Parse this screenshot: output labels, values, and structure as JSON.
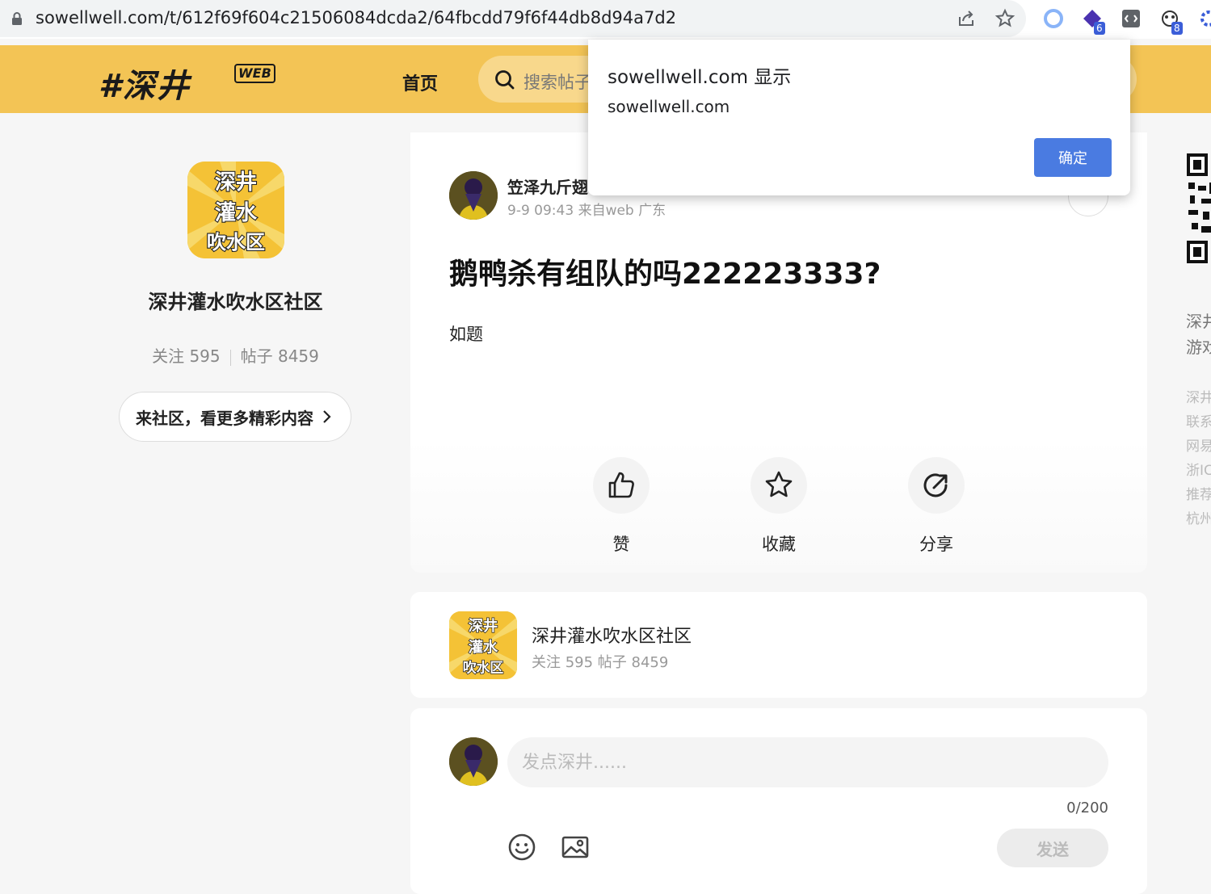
{
  "browser": {
    "url": "sowellwell.com/t/612f69f604c21506084dcda2/64fbcdd79f6f44db8d94a7d2",
    "ext_badge_1": "6",
    "ext_badge_2": "8"
  },
  "header": {
    "logo": "#深井",
    "logo_badge": "WEB",
    "nav_home": "首页",
    "search_placeholder": "搜索帖子"
  },
  "community": {
    "avatar_text": [
      "深井",
      "灌水",
      "吹水区"
    ],
    "name": "深井灌水吹水区社区",
    "follow": "关注 595",
    "posts": "帖子 8459",
    "stats_line": "关注 595 帖子 8459",
    "cta": "来社区，看更多精彩内容"
  },
  "post": {
    "author": "笠泽九斤翅",
    "meta": "9-9 09:43 来自web 广东",
    "title": "鹅鸭杀有组队的吗222223333?",
    "body": "如题",
    "actions": {
      "like": "赞",
      "favorite": "收藏",
      "share": "分享"
    }
  },
  "comment": {
    "placeholder": "发点深井......",
    "count": "0/200",
    "send": "发送"
  },
  "sidebar": {
    "title_lines": [
      "深井",
      "游戏"
    ],
    "links": [
      "深井",
      "联系",
      "网易",
      "浙IC",
      "推荐",
      "杭州"
    ]
  },
  "dialog": {
    "title": "sowellwell.com 显示",
    "message": "sowellwell.com",
    "ok": "确定"
  },
  "colors": {
    "header_bg": "#f3c455",
    "dialog_button": "#4a7be1",
    "page_bg": "#f6f6f6"
  }
}
